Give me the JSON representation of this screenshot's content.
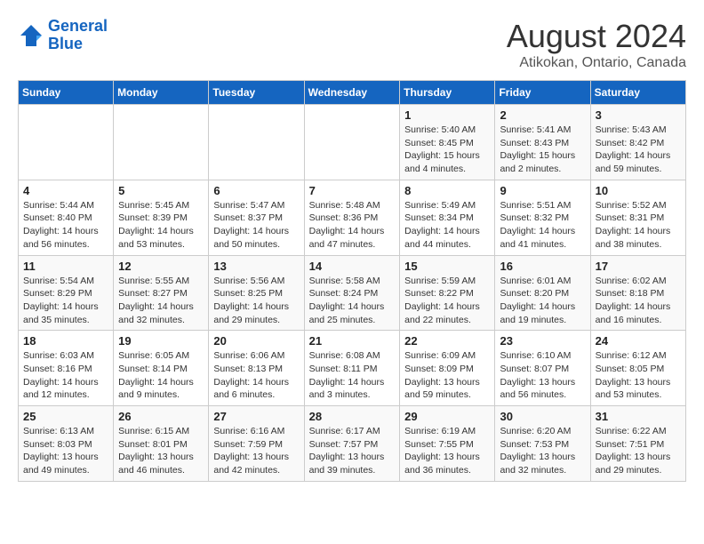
{
  "header": {
    "logo_line1": "General",
    "logo_line2": "Blue",
    "main_title": "August 2024",
    "subtitle": "Atikokan, Ontario, Canada"
  },
  "days_of_week": [
    "Sunday",
    "Monday",
    "Tuesday",
    "Wednesday",
    "Thursday",
    "Friday",
    "Saturday"
  ],
  "weeks": [
    [
      {
        "day": "",
        "info": ""
      },
      {
        "day": "",
        "info": ""
      },
      {
        "day": "",
        "info": ""
      },
      {
        "day": "",
        "info": ""
      },
      {
        "day": "1",
        "info": "Sunrise: 5:40 AM\nSunset: 8:45 PM\nDaylight: 15 hours\nand 4 minutes."
      },
      {
        "day": "2",
        "info": "Sunrise: 5:41 AM\nSunset: 8:43 PM\nDaylight: 15 hours\nand 2 minutes."
      },
      {
        "day": "3",
        "info": "Sunrise: 5:43 AM\nSunset: 8:42 PM\nDaylight: 14 hours\nand 59 minutes."
      }
    ],
    [
      {
        "day": "4",
        "info": "Sunrise: 5:44 AM\nSunset: 8:40 PM\nDaylight: 14 hours\nand 56 minutes."
      },
      {
        "day": "5",
        "info": "Sunrise: 5:45 AM\nSunset: 8:39 PM\nDaylight: 14 hours\nand 53 minutes."
      },
      {
        "day": "6",
        "info": "Sunrise: 5:47 AM\nSunset: 8:37 PM\nDaylight: 14 hours\nand 50 minutes."
      },
      {
        "day": "7",
        "info": "Sunrise: 5:48 AM\nSunset: 8:36 PM\nDaylight: 14 hours\nand 47 minutes."
      },
      {
        "day": "8",
        "info": "Sunrise: 5:49 AM\nSunset: 8:34 PM\nDaylight: 14 hours\nand 44 minutes."
      },
      {
        "day": "9",
        "info": "Sunrise: 5:51 AM\nSunset: 8:32 PM\nDaylight: 14 hours\nand 41 minutes."
      },
      {
        "day": "10",
        "info": "Sunrise: 5:52 AM\nSunset: 8:31 PM\nDaylight: 14 hours\nand 38 minutes."
      }
    ],
    [
      {
        "day": "11",
        "info": "Sunrise: 5:54 AM\nSunset: 8:29 PM\nDaylight: 14 hours\nand 35 minutes."
      },
      {
        "day": "12",
        "info": "Sunrise: 5:55 AM\nSunset: 8:27 PM\nDaylight: 14 hours\nand 32 minutes."
      },
      {
        "day": "13",
        "info": "Sunrise: 5:56 AM\nSunset: 8:25 PM\nDaylight: 14 hours\nand 29 minutes."
      },
      {
        "day": "14",
        "info": "Sunrise: 5:58 AM\nSunset: 8:24 PM\nDaylight: 14 hours\nand 25 minutes."
      },
      {
        "day": "15",
        "info": "Sunrise: 5:59 AM\nSunset: 8:22 PM\nDaylight: 14 hours\nand 22 minutes."
      },
      {
        "day": "16",
        "info": "Sunrise: 6:01 AM\nSunset: 8:20 PM\nDaylight: 14 hours\nand 19 minutes."
      },
      {
        "day": "17",
        "info": "Sunrise: 6:02 AM\nSunset: 8:18 PM\nDaylight: 14 hours\nand 16 minutes."
      }
    ],
    [
      {
        "day": "18",
        "info": "Sunrise: 6:03 AM\nSunset: 8:16 PM\nDaylight: 14 hours\nand 12 minutes."
      },
      {
        "day": "19",
        "info": "Sunrise: 6:05 AM\nSunset: 8:14 PM\nDaylight: 14 hours\nand 9 minutes."
      },
      {
        "day": "20",
        "info": "Sunrise: 6:06 AM\nSunset: 8:13 PM\nDaylight: 14 hours\nand 6 minutes."
      },
      {
        "day": "21",
        "info": "Sunrise: 6:08 AM\nSunset: 8:11 PM\nDaylight: 14 hours\nand 3 minutes."
      },
      {
        "day": "22",
        "info": "Sunrise: 6:09 AM\nSunset: 8:09 PM\nDaylight: 13 hours\nand 59 minutes."
      },
      {
        "day": "23",
        "info": "Sunrise: 6:10 AM\nSunset: 8:07 PM\nDaylight: 13 hours\nand 56 minutes."
      },
      {
        "day": "24",
        "info": "Sunrise: 6:12 AM\nSunset: 8:05 PM\nDaylight: 13 hours\nand 53 minutes."
      }
    ],
    [
      {
        "day": "25",
        "info": "Sunrise: 6:13 AM\nSunset: 8:03 PM\nDaylight: 13 hours\nand 49 minutes."
      },
      {
        "day": "26",
        "info": "Sunrise: 6:15 AM\nSunset: 8:01 PM\nDaylight: 13 hours\nand 46 minutes."
      },
      {
        "day": "27",
        "info": "Sunrise: 6:16 AM\nSunset: 7:59 PM\nDaylight: 13 hours\nand 42 minutes."
      },
      {
        "day": "28",
        "info": "Sunrise: 6:17 AM\nSunset: 7:57 PM\nDaylight: 13 hours\nand 39 minutes."
      },
      {
        "day": "29",
        "info": "Sunrise: 6:19 AM\nSunset: 7:55 PM\nDaylight: 13 hours\nand 36 minutes."
      },
      {
        "day": "30",
        "info": "Sunrise: 6:20 AM\nSunset: 7:53 PM\nDaylight: 13 hours\nand 32 minutes."
      },
      {
        "day": "31",
        "info": "Sunrise: 6:22 AM\nSunset: 7:51 PM\nDaylight: 13 hours\nand 29 minutes."
      }
    ]
  ]
}
